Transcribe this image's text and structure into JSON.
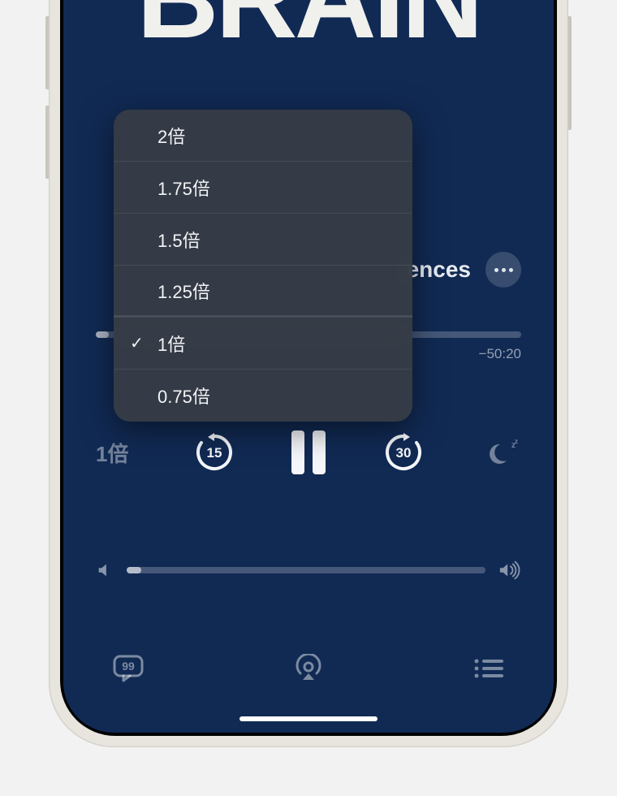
{
  "artwork": {
    "title_fragment": "BRAIN"
  },
  "episode": {
    "visible_title_fragment": "ences"
  },
  "playback": {
    "remaining_time": "−50:20",
    "speed_label": "1倍"
  },
  "speed_menu": {
    "options": [
      {
        "label": "2倍",
        "selected": false
      },
      {
        "label": "1.75倍",
        "selected": false
      },
      {
        "label": "1.5倍",
        "selected": false
      },
      {
        "label": "1.25倍",
        "selected": false
      },
      {
        "label": "1倍",
        "selected": true
      },
      {
        "label": "0.75倍",
        "selected": false
      }
    ]
  },
  "icons": {
    "more": "ellipsis",
    "skip_back": "15",
    "skip_forward": "30",
    "sleep": "moon-zz",
    "quotes": "chat-quote",
    "airplay": "airplay",
    "queue": "list"
  },
  "colors": {
    "background": "#112a54",
    "menu_bg": "#363c46",
    "accent_muted": "rgba(255,255,255,0.42)"
  }
}
